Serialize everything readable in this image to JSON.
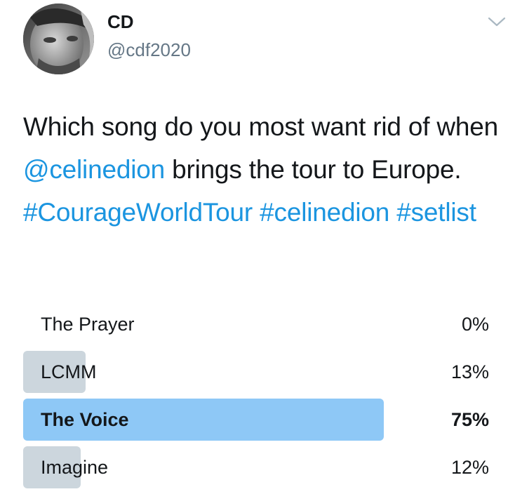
{
  "tweet": {
    "display_name": "CD",
    "handle": "@cdf2020",
    "text_parts": [
      {
        "text": "Which song do you most want rid of when ",
        "type": "plain"
      },
      {
        "text": "@celinedion",
        "type": "mention"
      },
      {
        "text": " brings the tour to Europe. ",
        "type": "plain"
      },
      {
        "text": "#CourageWorldTour",
        "type": "hashtag"
      },
      {
        "text": " ",
        "type": "plain"
      },
      {
        "text": "#celinedion",
        "type": "hashtag"
      },
      {
        "text": " ",
        "type": "plain"
      },
      {
        "text": "#setlist",
        "type": "hashtag"
      }
    ]
  },
  "poll": {
    "options": [
      {
        "label": "The Prayer",
        "percent_label": "0%",
        "percent": 0,
        "winner": false
      },
      {
        "label": "LCMM",
        "percent_label": "13%",
        "percent": 13,
        "winner": false
      },
      {
        "label": "The Voice",
        "percent_label": "75%",
        "percent": 75,
        "winner": true
      },
      {
        "label": "Imagine",
        "percent_label": "12%",
        "percent": 12,
        "winner": false
      }
    ]
  },
  "colors": {
    "link": "#1b95e0",
    "bar_default": "#ccd6dd",
    "bar_winner": "#8ec8f6",
    "text": "#14171a",
    "secondary": "#657786"
  },
  "icons": {
    "menu": "chevron-down-icon"
  }
}
